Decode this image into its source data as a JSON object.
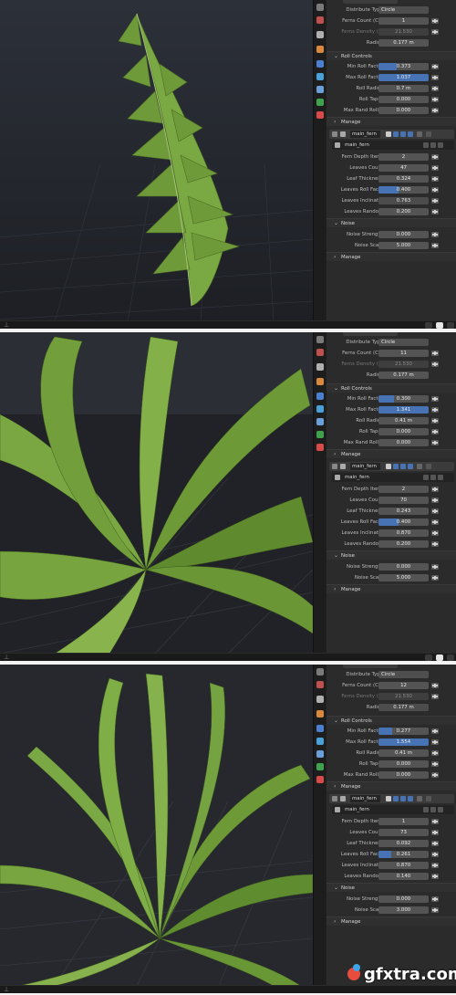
{
  "panels": [
    {
      "id": "panel-1",
      "distribute_label": "Distribute Type",
      "distribute_value": "Circle",
      "ferns_count_label": "Ferns Count (C...",
      "ferns_count_value": "1",
      "ferns_density_label": "Ferns Density (...",
      "ferns_density_value": "21.530",
      "radius_label": "Radius",
      "radius_value": "0.177 m",
      "roll_controls_title": "Roll Controls",
      "min_roll_label": "Min Roll Factor",
      "min_roll_value": "0.373",
      "min_roll_fill": 0.37,
      "max_roll_label": "Max Roll Factor",
      "max_roll_value": "1.037",
      "max_roll_fill": 1.0,
      "roll_radius_label": "Roll Radius",
      "roll_radius_value": "0.7 m",
      "roll_taper_label": "Roll Taper",
      "roll_taper_value": "0.000",
      "max_rand_label": "Max Rand Roll...",
      "max_rand_value": "0.000",
      "manage1_label": "Manage",
      "node_name": "main_fern",
      "sub_name": "main_fern",
      "depth_label": "Fern Depth Iter...",
      "depth_value": "2",
      "leaves_count_label": "Leaves Count",
      "leaves_count_value": "47",
      "leaf_thick_label": "Leaf Thickness",
      "leaf_thick_value": "0.324",
      "leaves_roll_label": "Leaves Roll Fac...",
      "leaves_roll_value": "0.400",
      "leaves_roll_fill": 0.4,
      "leaves_incl_label": "Leaves Inclinat...",
      "leaves_incl_value": "0.763",
      "leaves_rand_label": "Leaves Rando...",
      "leaves_rand_value": "0.200",
      "noise_title": "Noise",
      "noise_strength_label": "Noise Strength",
      "noise_strength_value": "0.000",
      "noise_scale_label": "Noise Scale",
      "noise_scale_value": "5.000",
      "manage2_label": "Manage"
    },
    {
      "id": "panel-2",
      "distribute_label": "Distribute Type",
      "distribute_value": "Circle",
      "ferns_count_label": "Ferns Count (C...",
      "ferns_count_value": "11",
      "ferns_density_label": "Ferns Density (...",
      "ferns_density_value": "21.530",
      "radius_label": "Radius",
      "radius_value": "0.177 m",
      "roll_controls_title": "Roll Controls",
      "min_roll_label": "Min Roll Factor",
      "min_roll_value": "0.300",
      "min_roll_fill": 0.3,
      "max_roll_label": "Max Roll Factor",
      "max_roll_value": "1.341",
      "max_roll_fill": 1.0,
      "roll_radius_label": "Roll Radius",
      "roll_radius_value": "0.41 m",
      "roll_taper_label": "Roll Taper",
      "roll_taper_value": "0.000",
      "max_rand_label": "Max Rand Roll...",
      "max_rand_value": "0.000",
      "manage1_label": "Manage",
      "node_name": "main_fern",
      "sub_name": "main_fern",
      "depth_label": "Fern Depth Iter...",
      "depth_value": "2",
      "leaves_count_label": "Leaves Count",
      "leaves_count_value": "70",
      "leaf_thick_label": "Leaf Thickness",
      "leaf_thick_value": "0.243",
      "leaves_roll_label": "Leaves Roll Fac...",
      "leaves_roll_value": "0.400",
      "leaves_roll_fill": 0.4,
      "leaves_incl_label": "Leaves Inclinat...",
      "leaves_incl_value": "0.870",
      "leaves_rand_label": "Leaves Rando...",
      "leaves_rand_value": "0.200",
      "noise_title": "Noise",
      "noise_strength_label": "Noise Strength",
      "noise_strength_value": "0.000",
      "noise_scale_label": "Noise Scale",
      "noise_scale_value": "5.000",
      "manage2_label": "Manage"
    },
    {
      "id": "panel-3",
      "distribute_label": "Distribute Type",
      "distribute_value": "Circle",
      "ferns_count_label": "Ferns Count (C...",
      "ferns_count_value": "12",
      "ferns_density_label": "Ferns Density (...",
      "ferns_density_value": "21.530",
      "radius_label": "Radius",
      "radius_value": "0.177 m",
      "roll_controls_title": "Roll Controls",
      "min_roll_label": "Min Roll Factor",
      "min_roll_value": "0.277",
      "min_roll_fill": 0.28,
      "max_roll_label": "Max Roll Factor",
      "max_roll_value": "1.554",
      "max_roll_fill": 1.0,
      "roll_radius_label": "Roll Radius",
      "roll_radius_value": "0.41 m",
      "roll_taper_label": "Roll Taper",
      "roll_taper_value": "0.000",
      "max_rand_label": "Max Rand Roll...",
      "max_rand_value": "0.000",
      "manage1_label": "Manage",
      "node_name": "main_fern",
      "sub_name": "main_fern",
      "depth_label": "Fern Depth Iter...",
      "depth_value": "1",
      "leaves_count_label": "Leaves Count",
      "leaves_count_value": "73",
      "leaf_thick_label": "Leaf Thickness",
      "leaf_thick_value": "0.092",
      "leaves_roll_label": "Leaves Roll Fac...",
      "leaves_roll_value": "0.261",
      "leaves_roll_fill": 0.26,
      "leaves_incl_label": "Leaves Inclinat...",
      "leaves_incl_value": "0.870",
      "leaves_rand_label": "Leaves Rando...",
      "leaves_rand_value": "0.140",
      "noise_title": "Noise",
      "noise_strength_label": "Noise Strength",
      "noise_strength_value": "0.000",
      "noise_scale_label": "Noise Scale",
      "noise_scale_value": "3.000",
      "manage2_label": "Manage"
    }
  ],
  "watermark": {
    "text": "gfxtra.com"
  },
  "colors": {
    "accent_blue": "#4772b3",
    "fern_green": "#6f9a3a",
    "panel_bg": "#2b2b2b",
    "viewport_bg": "#2a2d34"
  },
  "icons": [
    "pin-icon",
    "render-icon",
    "scene-icon",
    "object-icon",
    "modifier-icon",
    "particles-icon",
    "physics-icon",
    "constraints-icon",
    "data-icon",
    "material-icon",
    "keyframe-icon"
  ]
}
